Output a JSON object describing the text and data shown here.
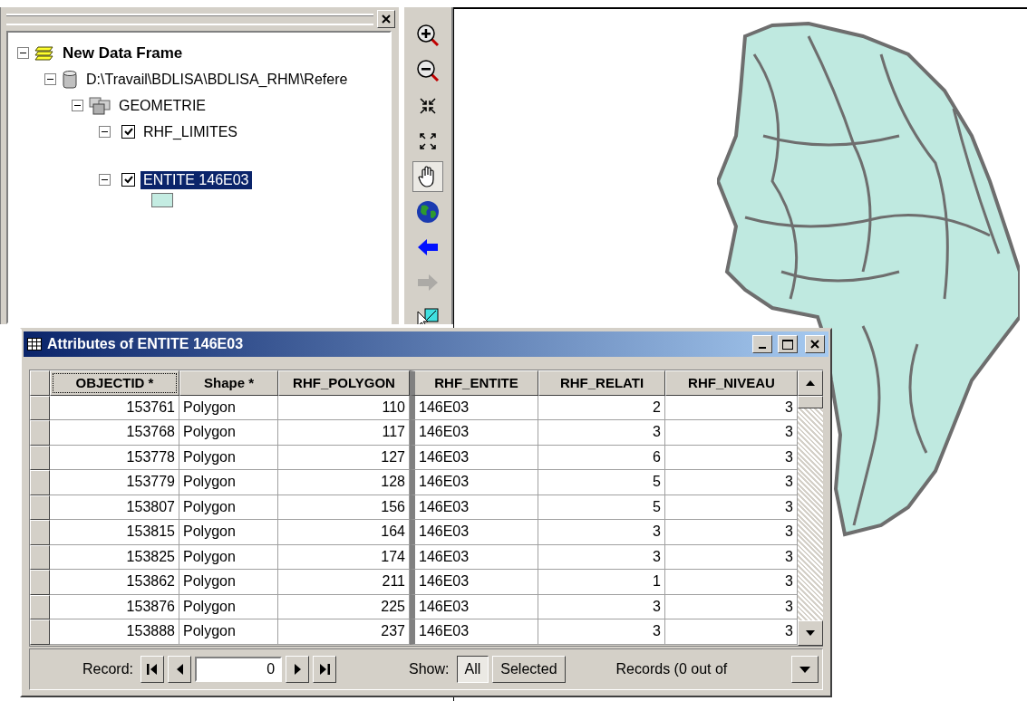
{
  "toc": {
    "tree": [
      {
        "label": "New Data Frame",
        "kind": "frame",
        "expanded": true,
        "children": [
          {
            "label": "D:\\Travail\\BDLISA\\BDLISA_RHM\\Refere",
            "kind": "database",
            "expanded": true,
            "children": [
              {
                "label": "GEOMETRIE",
                "kind": "dataset",
                "expanded": true,
                "children": [
                  {
                    "label": "RHF_LIMITES",
                    "kind": "line-layer",
                    "expanded": true,
                    "checked": true,
                    "selected": false
                  },
                  {
                    "label": "ENTITE 146E03",
                    "kind": "polygon-layer",
                    "expanded": true,
                    "checked": true,
                    "selected": true
                  }
                ]
              }
            ]
          }
        ]
      }
    ]
  },
  "tools": [
    {
      "kind": "zoom-in",
      "selected": false,
      "disabled": false
    },
    {
      "kind": "zoom-out",
      "selected": false,
      "disabled": false
    },
    {
      "kind": "fixed-zoom-in",
      "selected": false,
      "disabled": false
    },
    {
      "kind": "fixed-zoom-out",
      "selected": false,
      "disabled": false
    },
    {
      "kind": "pan",
      "selected": true,
      "disabled": false
    },
    {
      "kind": "full-extent",
      "selected": false,
      "disabled": false
    },
    {
      "kind": "back",
      "selected": false,
      "disabled": false
    },
    {
      "kind": "forward",
      "selected": false,
      "disabled": true
    },
    {
      "kind": "select",
      "selected": false,
      "disabled": false
    }
  ],
  "attributes_window": {
    "title": "Attributes of ENTITE 146E03",
    "columns": [
      {
        "label": "OBJECTID *",
        "numeric": true,
        "selected": true
      },
      {
        "label": "Shape *",
        "numeric": false,
        "selected": false
      },
      {
        "label": "RHF_POLYGON",
        "numeric": true,
        "selected": false
      },
      {
        "label": "RHF_ENTITE",
        "numeric": false,
        "selected": false
      },
      {
        "label": "RHF_RELATI",
        "numeric": true,
        "selected": false
      },
      {
        "label": "RHF_NIVEAU",
        "numeric": true,
        "selected": false
      }
    ],
    "rows": [
      [
        "153761",
        "Polygon",
        "110",
        "146E03",
        "2",
        "3"
      ],
      [
        "153768",
        "Polygon",
        "117",
        "146E03",
        "3",
        "3"
      ],
      [
        "153778",
        "Polygon",
        "127",
        "146E03",
        "6",
        "3"
      ],
      [
        "153779",
        "Polygon",
        "128",
        "146E03",
        "5",
        "3"
      ],
      [
        "153807",
        "Polygon",
        "156",
        "146E03",
        "5",
        "3"
      ],
      [
        "153815",
        "Polygon",
        "164",
        "146E03",
        "3",
        "3"
      ],
      [
        "153825",
        "Polygon",
        "174",
        "146E03",
        "3",
        "3"
      ],
      [
        "153862",
        "Polygon",
        "211",
        "146E03",
        "1",
        "3"
      ],
      [
        "153876",
        "Polygon",
        "225",
        "146E03",
        "3",
        "3"
      ],
      [
        "153888",
        "Polygon",
        "237",
        "146E03",
        "3",
        "3"
      ]
    ],
    "footer": {
      "record_label": "Record:",
      "record_value": "0",
      "show_label": "Show:",
      "show_options": [
        {
          "label": "All",
          "selected": true
        },
        {
          "label": "Selected",
          "selected": false
        }
      ],
      "records_text": "Records (0 out of"
    }
  }
}
